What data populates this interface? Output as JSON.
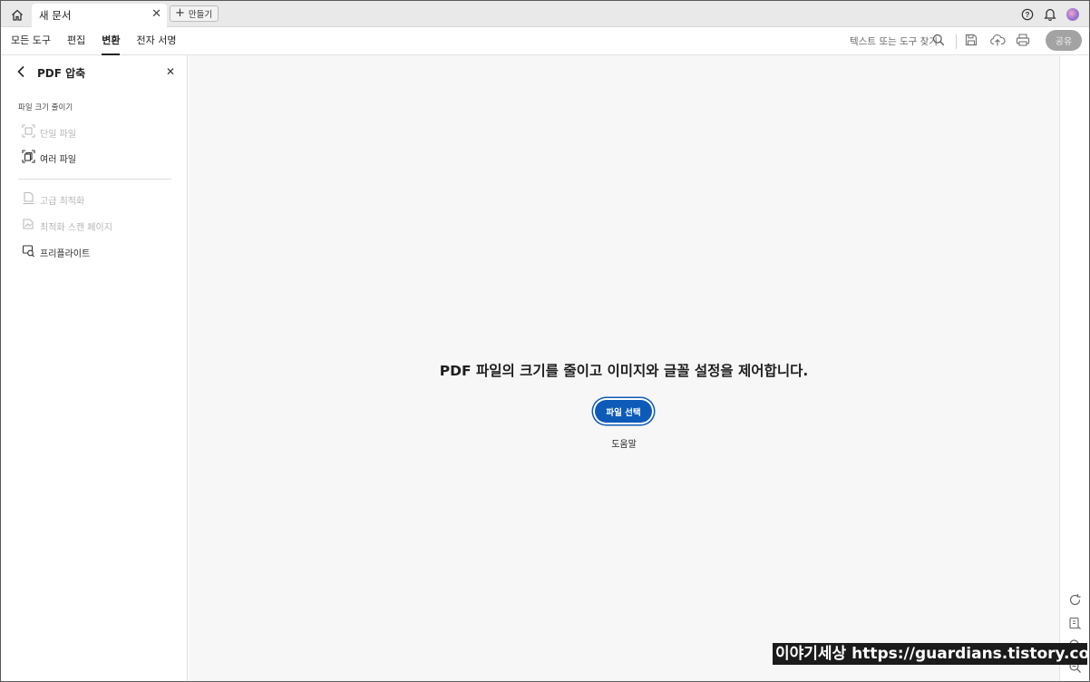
{
  "titlebar": {
    "tab_title": "새 문서",
    "create_label": "만들기"
  },
  "menubar": {
    "items": [
      "모든 도구",
      "편집",
      "변환",
      "전자 서명"
    ],
    "active": "변환",
    "search_placeholder": "텍스트 또는 도구 찾기",
    "share_label": "공유"
  },
  "left_panel": {
    "title": "PDF 압축",
    "section_label": "파일 크기 줄이기",
    "group1": [
      {
        "label": "단일 파일",
        "enabled": false
      },
      {
        "label": "여러 파일",
        "enabled": true
      }
    ],
    "group2": [
      {
        "label": "고급 최적화",
        "enabled": false
      },
      {
        "label": "최적화 스캔 페이지",
        "enabled": false
      },
      {
        "label": "프리플라이트",
        "enabled": true
      }
    ]
  },
  "main": {
    "headline": "PDF 파일의 크기를 줄이고 이미지와 글꼴 설정을 제어합니다.",
    "select_button": "파일 선택",
    "help_link": "도움말"
  },
  "watermark": "이야기세상 https://guardians.tistory.com",
  "colors": {
    "primary_button": "#0d5ab8",
    "share_disabled": "#a3a3a3",
    "canvas_bg": "#f7f7f7"
  }
}
